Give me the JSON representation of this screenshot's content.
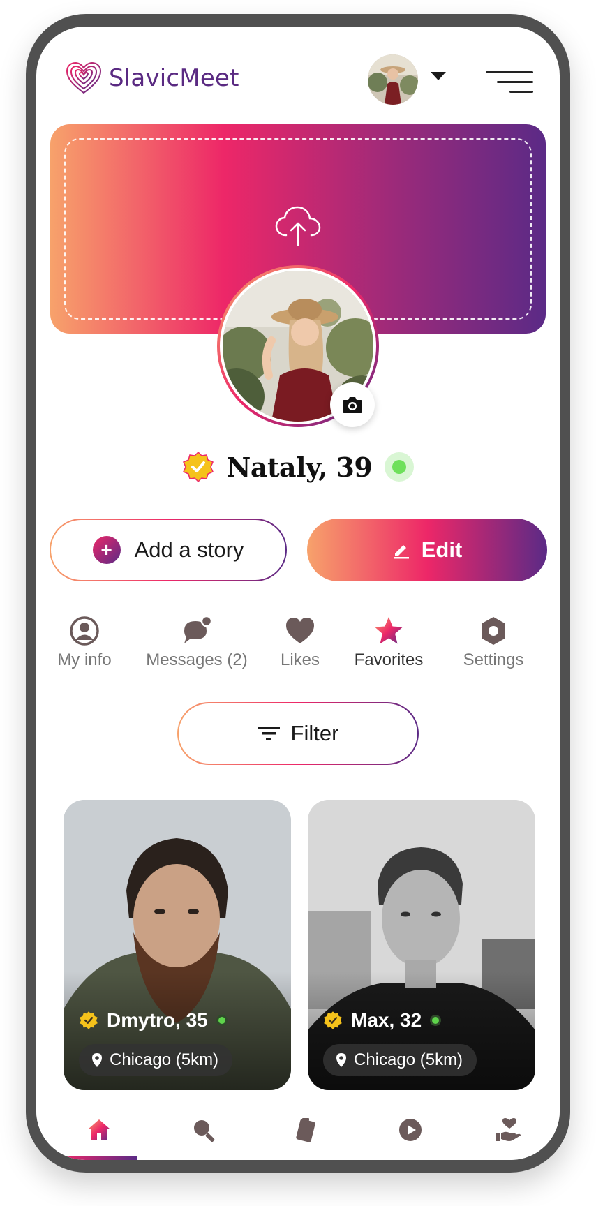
{
  "header": {
    "brand": "SlavicMeet"
  },
  "profile": {
    "name": "Nataly, 39"
  },
  "actions": {
    "add_story": "Add a story",
    "edit": "Edit",
    "filter": "Filter"
  },
  "tabs": [
    {
      "label": "My info",
      "icon": "user-circle-icon"
    },
    {
      "label": "Messages (2)",
      "icon": "chat-bubble-icon"
    },
    {
      "label": "Likes",
      "icon": "heart-icon"
    },
    {
      "label": "Favorites",
      "icon": "star-icon"
    },
    {
      "label": "Settings",
      "icon": "gear-icon"
    }
  ],
  "cards": [
    {
      "name": "Dmytro, 35",
      "location": "Chicago (5km)"
    },
    {
      "name": "Max, 32",
      "location": "Chicago (5km)"
    }
  ],
  "bottom_nav": [
    "home-icon",
    "search-icon",
    "cards-icon",
    "play-icon",
    "hand-heart-icon"
  ],
  "colors": {
    "brand_purple": "#5a2a82",
    "gradient_start": "#f7a26b",
    "gradient_mid": "#ed2768",
    "gradient_end": "#5b2a86",
    "online": "#6ee05b",
    "icon_gray": "#6b5a5a"
  }
}
